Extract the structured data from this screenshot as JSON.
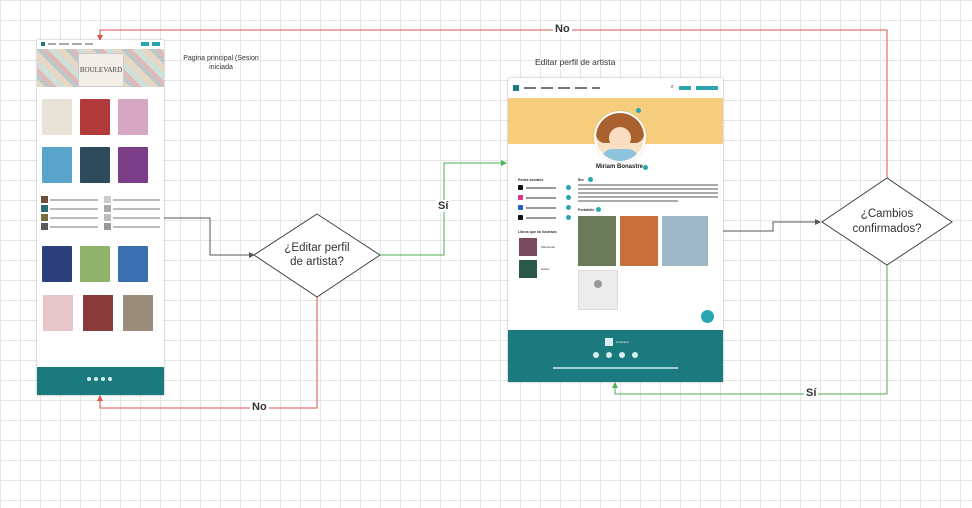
{
  "nodes": {
    "main_page_caption": "Pagina principal (Sesion iniciada",
    "edit_profile_caption": "Editar perfil de artista",
    "decision_edit": [
      "¿Editar perfil",
      "de artista?"
    ],
    "decision_confirm": [
      "¿Cambios",
      "confirmados?"
    ]
  },
  "edges": {
    "no_top": "No",
    "si_edit": "Sí",
    "no_bottom": "No",
    "si_confirm": "Sí"
  },
  "colors": {
    "no_edge": "#d9534f",
    "si_edge": "#4caf50",
    "neutral_edge": "#555555",
    "brand_teal": "#1b7a7e",
    "banner": "#f6cd7c"
  },
  "left_mockup": {
    "hero_text": "BOULEVARD"
  },
  "right_mockup": {
    "artist_name": "Miriam Bonastre",
    "sections": {
      "social": "Redes sociales",
      "bio": "Bio",
      "portfolio": "Portafolio",
      "books": "Libros que ha ilustrado"
    },
    "books": [
      "Marionette",
      "Hachy"
    ],
    "footer_brand": "ArtGlobal"
  }
}
